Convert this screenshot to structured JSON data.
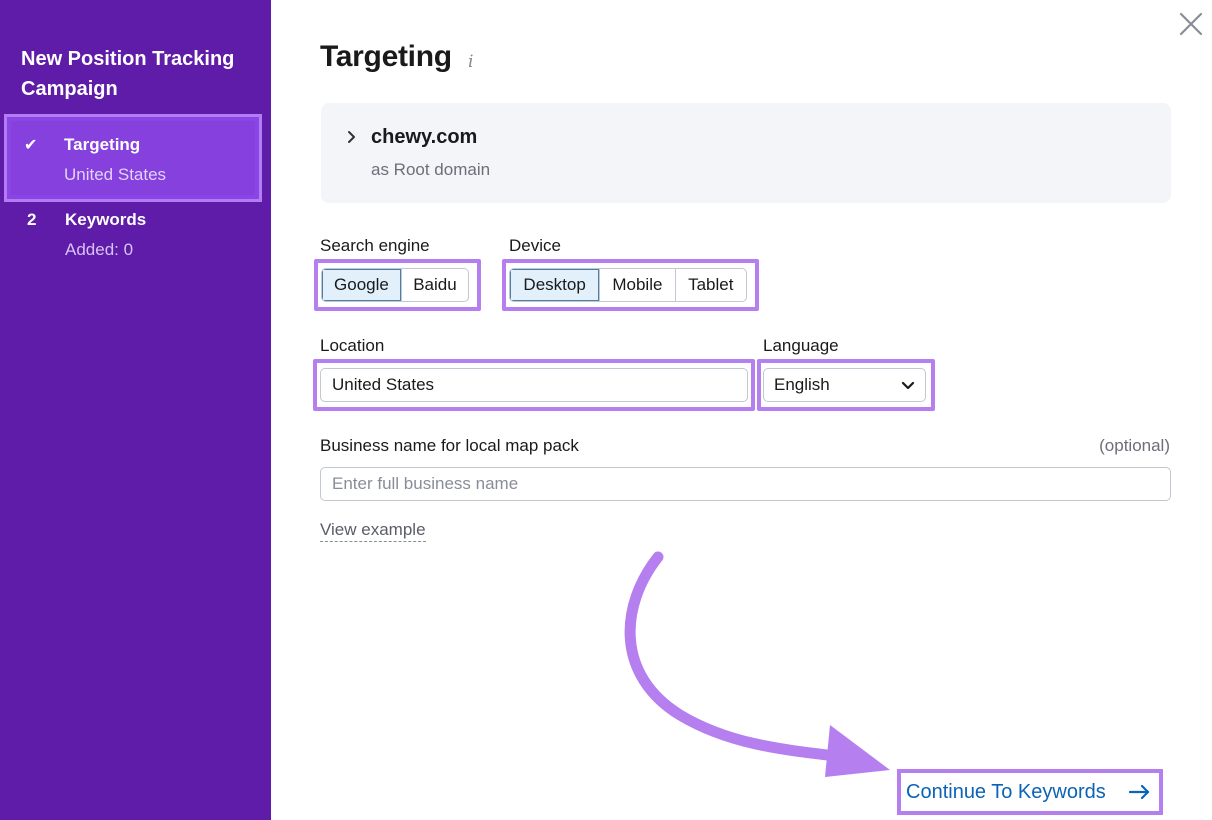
{
  "sidebar": {
    "title": "New Position Tracking Campaign",
    "steps": [
      {
        "marker": "✔",
        "label": "Targeting",
        "sub": "United States",
        "active": true
      },
      {
        "marker": "2",
        "label": "Keywords",
        "sub": "Added: 0",
        "active": false
      }
    ]
  },
  "main": {
    "title": "Targeting",
    "info_icon": "i",
    "domain": {
      "name": "chewy.com",
      "type": "as Root domain"
    },
    "search_engine": {
      "label": "Search engine",
      "options": [
        "Google",
        "Baidu"
      ],
      "selected": "Google"
    },
    "device": {
      "label": "Device",
      "options": [
        "Desktop",
        "Mobile",
        "Tablet"
      ],
      "selected": "Desktop"
    },
    "location": {
      "label": "Location",
      "value": "United States"
    },
    "language": {
      "label": "Language",
      "value": "English"
    },
    "business": {
      "label": "Business name for local map pack",
      "optional": "(optional)",
      "placeholder": "Enter full business name",
      "value": ""
    },
    "view_example": "View example",
    "continue_label": "Continue To Keywords"
  },
  "icons": {
    "close": "close-icon",
    "check": "check-icon",
    "chevron_right": "chevron-right-icon",
    "chevron_down": "chevron-down-icon",
    "arrow_right": "arrow-right-icon",
    "annotation_arrow": "curved-arrow-icon"
  },
  "colors": {
    "sidebar_bg": "#5e1ca8",
    "active_step_bg": "#8540de",
    "highlight": "#b57ff0",
    "selected_option_bg": "#e2f0fb",
    "link": "#0b63b6"
  }
}
